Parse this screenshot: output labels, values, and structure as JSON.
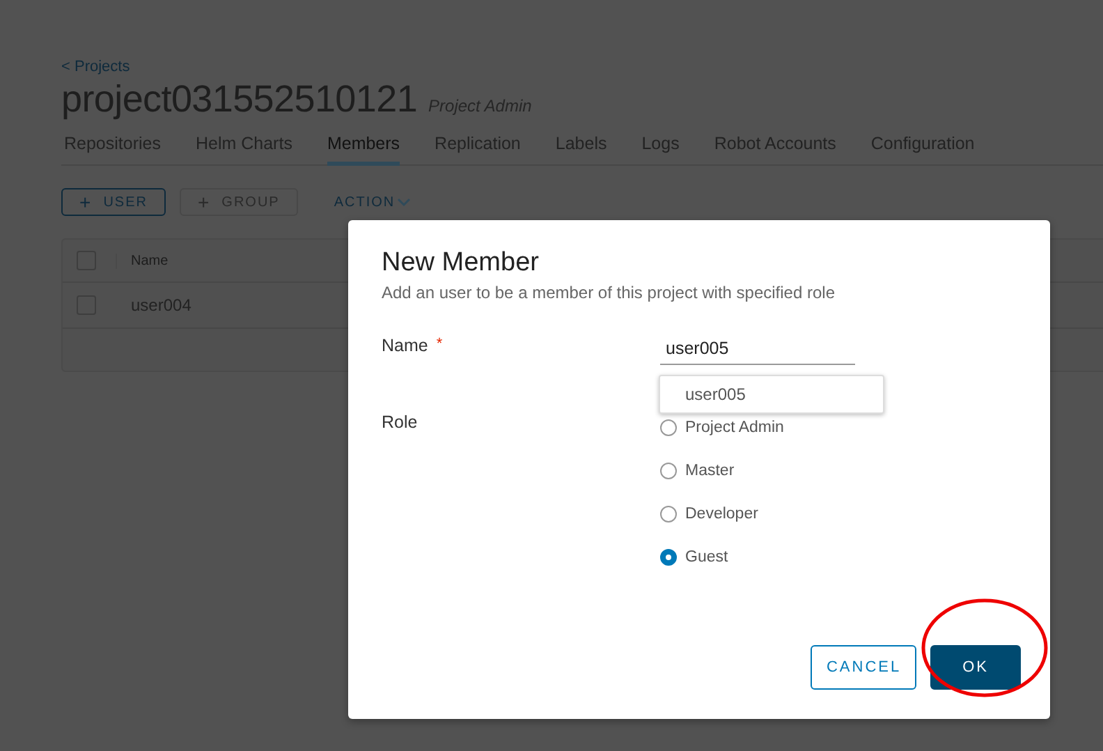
{
  "breadcrumb": "< Projects",
  "project": {
    "name": "project031552510121",
    "role": "Project Admin"
  },
  "tabs": [
    {
      "label": "Repositories",
      "selected": false
    },
    {
      "label": "Helm Charts",
      "selected": false
    },
    {
      "label": "Members",
      "selected": true
    },
    {
      "label": "Replication",
      "selected": false
    },
    {
      "label": "Labels",
      "selected": false
    },
    {
      "label": "Logs",
      "selected": false
    },
    {
      "label": "Robot Accounts",
      "selected": false
    },
    {
      "label": "Configuration",
      "selected": false
    }
  ],
  "toolbar": {
    "buttons": [
      {
        "icon": "+",
        "label": "USER",
        "disabled": false
      },
      {
        "icon": "+",
        "label": "GROUP",
        "disabled": true
      }
    ],
    "action": "ACTION"
  },
  "table": {
    "all_checked": false,
    "columns": [
      "Name"
    ],
    "rows": [
      {
        "name": "user004",
        "checked": false
      }
    ]
  },
  "dialog": {
    "title": "New Member",
    "subtitle": "Add an user to be a member of this project with specified role",
    "name_label": "Name",
    "required_mark": "*",
    "name_value": "user005",
    "suggestions": [
      "user005"
    ],
    "role_label": "Role",
    "roles": [
      {
        "label": "Project Admin",
        "selected": false
      },
      {
        "label": "Master",
        "selected": false
      },
      {
        "label": "Developer",
        "selected": false
      },
      {
        "label": "Guest",
        "selected": true
      }
    ],
    "buttons": [
      {
        "label": "CANCEL",
        "kind": "secondary"
      },
      {
        "label": "OK",
        "kind": "primary",
        "highlighted": true
      }
    ]
  }
}
